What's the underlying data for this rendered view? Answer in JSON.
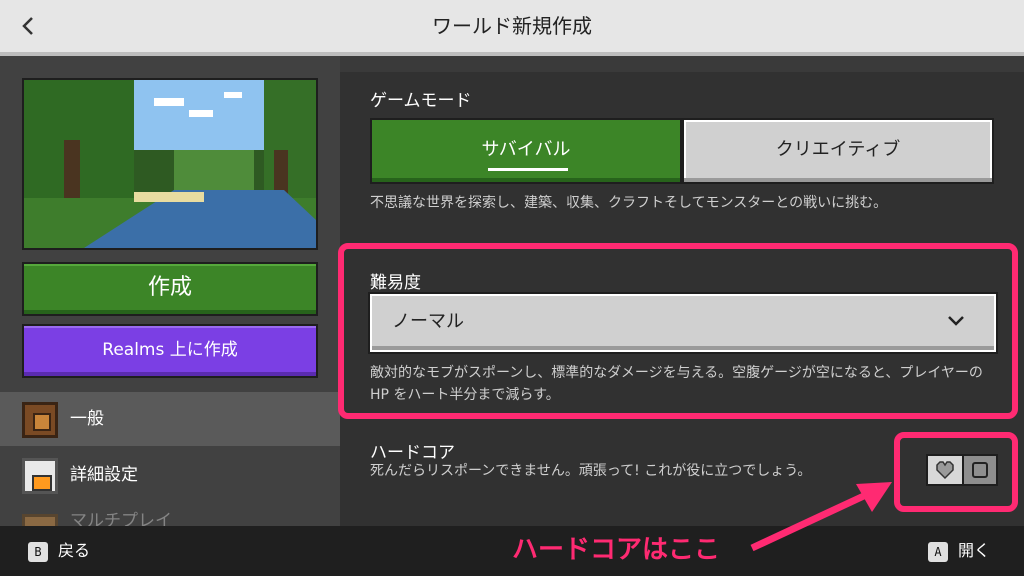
{
  "header": {
    "back_icon": "chevron-left-icon",
    "title": "ワールド新規作成"
  },
  "left": {
    "create_label": "作成",
    "realms_label": "Realms 上に作成",
    "nav": [
      {
        "label": "一般",
        "icon": "gear-icon",
        "active": true
      },
      {
        "label": "詳細設定",
        "icon": "furnace-icon",
        "active": false
      },
      {
        "label": "マルチプレイ",
        "icon": "multiplayer-icon",
        "active": false
      }
    ]
  },
  "game_mode": {
    "label": "ゲームモード",
    "options": [
      "サバイバル",
      "クリエイティブ"
    ],
    "selected": "サバイバル",
    "description": "不思議な世界を探索し、建築、収集、クラフトそしてモンスターとの戦いに挑む。"
  },
  "difficulty": {
    "label": "難易度",
    "value": "ノーマル",
    "description": "敵対的なモブがスポーンし、標準的なダメージを与える。空腹ゲージが空になると、プレイヤーの HP をハート半分まで減らす。"
  },
  "hardcore": {
    "label": "ハードコア",
    "description": "死んだらリスポーンできません。頑張って! これが役に立つでしょう。",
    "enabled": false
  },
  "footer": {
    "back_key": "B",
    "back_label": "戻る",
    "open_key": "A",
    "open_label": "開く"
  },
  "annotation": "ハードコアはここ",
  "colors": {
    "accent_green": "#3c8527",
    "realms_purple": "#7b3fe4",
    "highlight_pink": "#ff2a72"
  }
}
